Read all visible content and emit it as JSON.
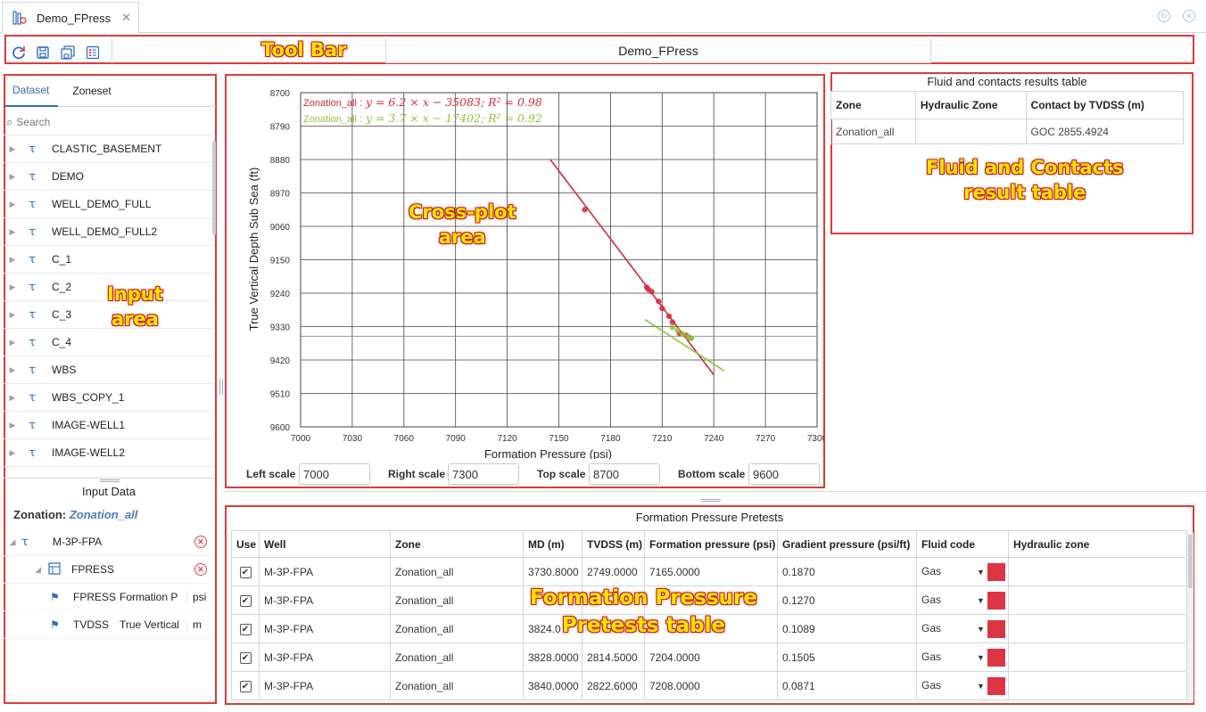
{
  "tab": {
    "title": "Demo_FPress",
    "close": "✕"
  },
  "toolbar": {
    "doc_title": "Demo_FPress"
  },
  "annotations": {
    "toolbar": "Tool Bar",
    "input": [
      "Input",
      "area"
    ],
    "crossplot": [
      "Cross-plot",
      "area"
    ],
    "fluid": [
      "Fluid and Contacts",
      "result table"
    ],
    "pretests": [
      "Formation Pressure",
      "Pretests table"
    ]
  },
  "left": {
    "tabs": [
      "Dataset",
      "Zoneset"
    ],
    "search_placeholder": "Search",
    "datasets": [
      "CLASTIC_BASEMENT",
      "DEMO",
      "WELL_DEMO_FULL",
      "WELL_DEMO_FULL2",
      "C_1",
      "C_2",
      "C_3",
      "C_4",
      "WBS",
      "WBS_COPY_1",
      "IMAGE-WELL1",
      "IMAGE-WELL2"
    ],
    "input_data_title": "Input Data",
    "zonation_label": "Zonation:",
    "zonation_value": "Zonation_all",
    "tree": {
      "well": "M-3P-FPA",
      "dataset": "FPRESS",
      "curves": [
        {
          "name": "FPRESS",
          "desc": "Formation P",
          "unit": "psi"
        },
        {
          "name": "TVDSS",
          "desc": "True Vertical",
          "unit": "m"
        }
      ]
    }
  },
  "chart_data": {
    "type": "scatter",
    "xlabel": "Formation Pressure (psi)",
    "ylabel": "True Vertical Depth Sub Sea (ft)",
    "xlim": [
      7000,
      7300
    ],
    "ylim": [
      8700,
      9600
    ],
    "y_inverted": true,
    "grid": true,
    "x_ticks": [
      "7000",
      "7030",
      "7060",
      "7090",
      "7120",
      "7150",
      "7180",
      "7210",
      "7240",
      "7270",
      "7300"
    ],
    "y_ticks": [
      "8700",
      "8790",
      "8880",
      "8970",
      "9060",
      "9150",
      "9240",
      "9330",
      "9420",
      "9510",
      "9600"
    ],
    "series": [
      {
        "label": "Zonation_all",
        "equation": "y = 6.2 × x − 35083; R² = 0.98",
        "color": "#d6293a",
        "line": [
          [
            7145,
            8880
          ],
          [
            7240,
            9460
          ]
        ],
        "points": [
          [
            7165,
            9015
          ],
          [
            7201,
            9224
          ],
          [
            7202,
            9230
          ],
          [
            7204,
            9236
          ],
          [
            7208,
            9262
          ],
          [
            7210,
            9281
          ],
          [
            7214,
            9302
          ],
          [
            7216,
            9318
          ],
          [
            7220,
            9348
          ],
          [
            7224,
            9354
          ],
          [
            7226,
            9360
          ]
        ]
      },
      {
        "label": "Zonation_all",
        "equation": "y = 3.7 × x − 17402; R² = 0.92",
        "color": "#8cc43c",
        "line": [
          [
            7200,
            9311
          ],
          [
            7246,
            9449
          ]
        ],
        "points": [
          [
            7216,
            9332
          ],
          [
            7219,
            9340
          ],
          [
            7222,
            9350
          ],
          [
            7225,
            9358
          ],
          [
            7227,
            9362
          ]
        ]
      }
    ],
    "extra_hline_y": 9356
  },
  "scales": [
    {
      "label": "Left scale",
      "value": "7000"
    },
    {
      "label": "Right scale",
      "value": "7300"
    },
    {
      "label": "Top scale",
      "value": "8700"
    },
    {
      "label": "Bottom scale",
      "value": "9600"
    }
  ],
  "fluid_table": {
    "title": "Fluid and contacts results table",
    "headers": [
      "Zone",
      "Hydraulic Zone",
      "Contact by TVDSS (m)"
    ],
    "rows": [
      [
        "Zonation_all",
        "",
        "GOC 2855.4924"
      ]
    ]
  },
  "pretests": {
    "title": "Formation Pressure Pretests",
    "headers": [
      "Use",
      "Well",
      "Zone",
      "MD (m)",
      "TVDSS (m)",
      "Formation pressure (psi)",
      "Gradient pressure (psi/ft)",
      "Fluid code",
      "Hydraulic zone"
    ],
    "rows": [
      [
        "✔",
        "M-3P-FPA",
        "Zonation_all",
        "3730.8000",
        "2749.0000",
        "7165.0000",
        "0.1870",
        "Gas",
        ""
      ],
      [
        "✔",
        "M-3P-FPA",
        "Zonation_all",
        "",
        "",
        "",
        "0.1270",
        "Gas",
        ""
      ],
      [
        "✔",
        "M-3P-FPA",
        "Zonation_all",
        "3824.0",
        "",
        "",
        "0.1089",
        "Gas",
        ""
      ],
      [
        "✔",
        "M-3P-FPA",
        "Zonation_all",
        "3828.0000",
        "2814.5000",
        "7204.0000",
        "0.1505",
        "Gas",
        ""
      ],
      [
        "✔",
        "M-3P-FPA",
        "Zonation_all",
        "3840.0000",
        "2822.6000",
        "7208.0000",
        "0.0871",
        "Gas",
        ""
      ]
    ],
    "fluid_color": "#de3545"
  }
}
